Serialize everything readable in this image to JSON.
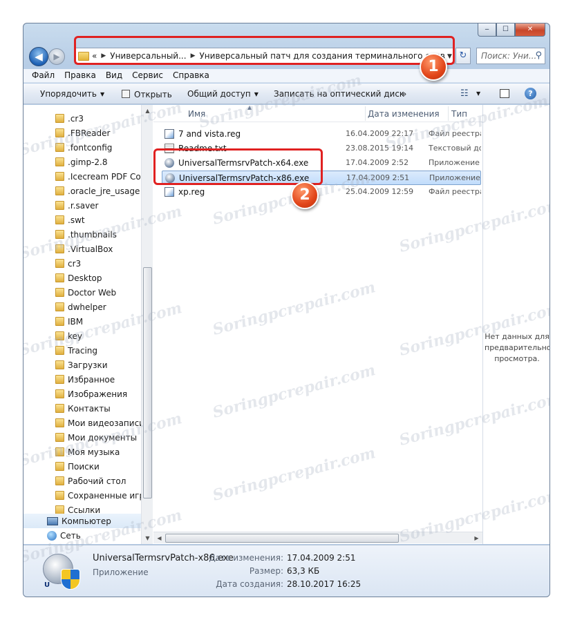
{
  "window": {
    "caption_buttons": {
      "minimize": "‒",
      "maximize": "☐",
      "close": "✕"
    }
  },
  "nav": {
    "back_glyph": "◀",
    "forward_glyph": "▶",
    "breadcrumb_prefix": "«",
    "breadcrumbs": [
      "Универсальный...",
      "Универсальный патч для создания терминального сервера"
    ],
    "refresh_glyph": "↻",
    "search_placeholder": "Поиск: Уни...",
    "search_glyph": "⚲"
  },
  "annotations": {
    "badge1": "1",
    "badge2": "2"
  },
  "menu": [
    "Файл",
    "Правка",
    "Вид",
    "Сервис",
    "Справка"
  ],
  "toolbar": {
    "organize": "Упорядочить",
    "open": "Открыть",
    "share": "Общий доступ",
    "burn": "Записать на оптический диск",
    "more": "»",
    "help": "?"
  },
  "sidebar": {
    "items": [
      ".cr3",
      ".FBReader",
      ".fontconfig",
      ".gimp-2.8",
      ".Icecream PDF Con",
      ".oracle_jre_usage",
      ".r.saver",
      ".swt",
      ".thumbnails",
      ".VirtualBox",
      "cr3",
      "Desktop",
      "Doctor Web",
      "dwhelper",
      "IBM",
      "key",
      "Tracing",
      "Загрузки",
      "Избранное",
      "Изображения",
      "Контакты",
      "Мои видеозаписи",
      "Мои документы",
      "Моя музыка",
      "Поиски",
      "Рабочий стол",
      "Сохраненные игры",
      "Ссылки"
    ],
    "computer": "Компьютер",
    "network": "Сеть"
  },
  "columns": {
    "name": "Имя",
    "date": "Дата изменения",
    "type": "Тип"
  },
  "files": [
    {
      "name": "7 and vista.reg",
      "date": "16.04.2009 22:17",
      "type": "Файл реестра",
      "icon": "reg-icon"
    },
    {
      "name": "Readme.txt",
      "date": "23.08.2015 19:14",
      "type": "Текстовый документ",
      "icon": "text-file-icon"
    },
    {
      "name": "UniversalTermsrvPatch-x64.exe",
      "date": "17.04.2009 2:52",
      "type": "Приложение",
      "icon": "exe-icon"
    },
    {
      "name": "UniversalTermsrvPatch-x86.exe",
      "date": "17.04.2009 2:51",
      "type": "Приложение",
      "icon": "exe-icon",
      "selected": true
    },
    {
      "name": "xp.reg",
      "date": "25.04.2009 12:59",
      "type": "Файл реестра",
      "icon": "reg-icon"
    }
  ],
  "preview": {
    "empty_text": "Нет данных для предварительного просмотра."
  },
  "details": {
    "name": "UniversalTermsrvPatch-x86.exe",
    "type": "Приложение",
    "icon_letter": "U",
    "modified_label": "Дата изменения:",
    "modified_value": "17.04.2009 2:51",
    "size_label": "Размер:",
    "size_value": "63,3 КБ",
    "created_label": "Дата создания:",
    "created_value": "28.10.2017 16:25"
  },
  "watermark": "Soringpcrepair.com",
  "colors": {
    "highlight": "#e02121",
    "badge": "#e2461a",
    "selection": "#c1dcfb"
  }
}
